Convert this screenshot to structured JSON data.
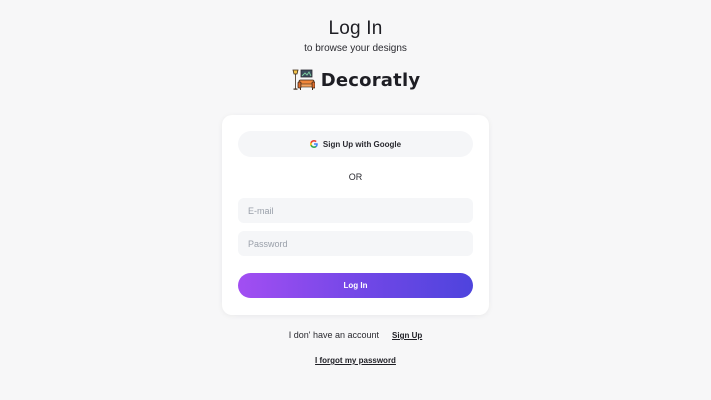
{
  "header": {
    "title": "Log In",
    "subtitle": "to browse your designs"
  },
  "brand": {
    "name": "Decoratly",
    "logo_icon": "furniture-sofa-lamp-icon"
  },
  "form": {
    "google_button_label": "Sign Up with Google",
    "google_icon": "google-icon",
    "divider_label": "OR",
    "email_placeholder": "E-mail",
    "password_placeholder": "Password",
    "login_button_label": "Log In",
    "login_gradient": [
      "#a24ef2",
      "#4e44dd"
    ]
  },
  "footer": {
    "account_prompt": "I don' have an account",
    "signup_link": "Sign Up",
    "forgot_link": "I forgot my password"
  }
}
